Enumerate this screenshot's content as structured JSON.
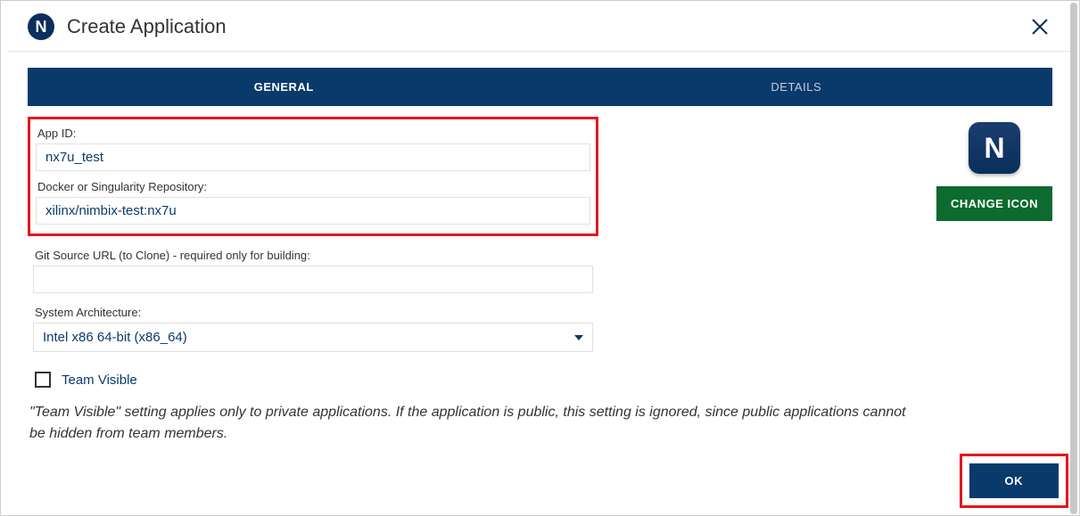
{
  "header": {
    "logo_letter": "N",
    "title": "Create Application"
  },
  "tabs": {
    "general": "GENERAL",
    "details": "DETAILS"
  },
  "form": {
    "app_id_label": "App ID:",
    "app_id_value": "nx7u_test",
    "repo_label": "Docker or Singularity Repository:",
    "repo_value": "xilinx/nimbix-test:nx7u",
    "git_label": "Git Source URL (to Clone) - required only for building:",
    "git_value": "",
    "arch_label": "System Architecture:",
    "arch_value": "Intel x86 64-bit (x86_64)",
    "team_visible_label": "Team Visible",
    "help_text": "\"Team Visible\" setting applies only to private applications. If the application is public, this setting is ignored, since public applications cannot be hidden from team members."
  },
  "icon_panel": {
    "icon_letter": "N",
    "change_label": "CHANGE ICON"
  },
  "footer": {
    "ok_label": "OK"
  }
}
